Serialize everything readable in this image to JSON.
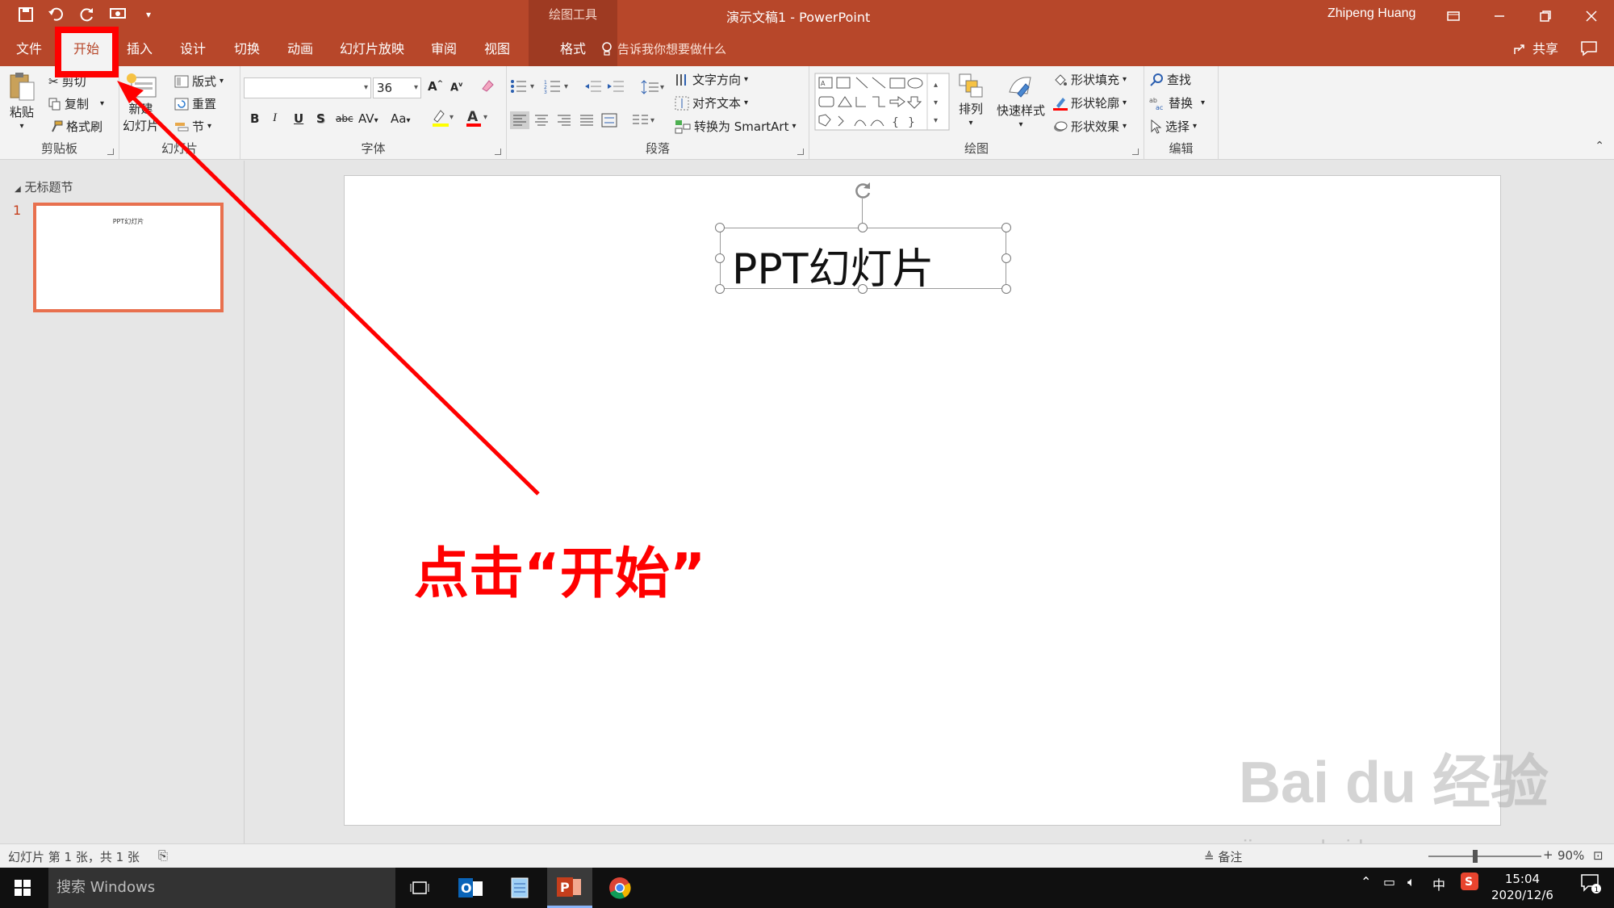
{
  "window": {
    "doc_title": "演示文稿1  -  PowerPoint",
    "context_label": "绘图工具",
    "user": "Zhipeng Huang"
  },
  "tabs": {
    "file": "文件",
    "home": "开始",
    "insert": "插入",
    "design": "设计",
    "transitions": "切换",
    "animations": "动画",
    "slideshow": "幻灯片放映",
    "review": "审阅",
    "view": "视图",
    "format": "格式",
    "tellme": "告诉我你想要做什么",
    "share": "共享"
  },
  "ribbon": {
    "clipboard": {
      "label": "剪贴板",
      "paste": "粘贴",
      "cut": "剪切",
      "copy": "复制",
      "format_painter": "格式刷"
    },
    "slides": {
      "label": "幻灯片",
      "new_slide_1": "新建",
      "new_slide_2": "幻灯片",
      "layout": "版式",
      "reset": "重置",
      "section": "节"
    },
    "font": {
      "label": "字体",
      "font_name": "",
      "font_size": "36",
      "bold": "B",
      "italic": "I",
      "underline": "U",
      "shadow": "S",
      "strike": "abc",
      "spacing": "AV",
      "case": "Aa",
      "grow": "A",
      "shrink": "A"
    },
    "paragraph": {
      "label": "段落",
      "text_direction": "文字方向",
      "align_text": "对齐文本",
      "smartart": "转换为 SmartArt"
    },
    "drawing": {
      "label": "绘图",
      "arrange": "排列",
      "quick_styles": "快速样式",
      "fill": "形状填充",
      "outline": "形状轮廓",
      "effects": "形状效果"
    },
    "editing": {
      "label": "编辑",
      "find": "查找",
      "replace": "替换",
      "select": "选择"
    }
  },
  "pane": {
    "section_name": "无标题节",
    "slide_number": "1",
    "thumb_text": "PPT幻灯片"
  },
  "slide": {
    "title_text": "PPT幻灯片"
  },
  "annotation": {
    "text": "点击“开始”",
    "color": "#ff0000"
  },
  "watermark": {
    "brand": "Bai du 经验",
    "url": "jingyan.baidu.com"
  },
  "status": {
    "slide_info": "幻灯片 第 1 张，共 1 张",
    "notes": "备注",
    "zoom": "90%"
  },
  "taskbar": {
    "search_placeholder": "搜索 Windows",
    "ime": "中",
    "time": "15:04",
    "date": "2020/12/6",
    "notif_count": "1"
  },
  "colors": {
    "accent": "#b7472a",
    "accent_dark": "#9e3a22",
    "selection": "#e8704e"
  }
}
